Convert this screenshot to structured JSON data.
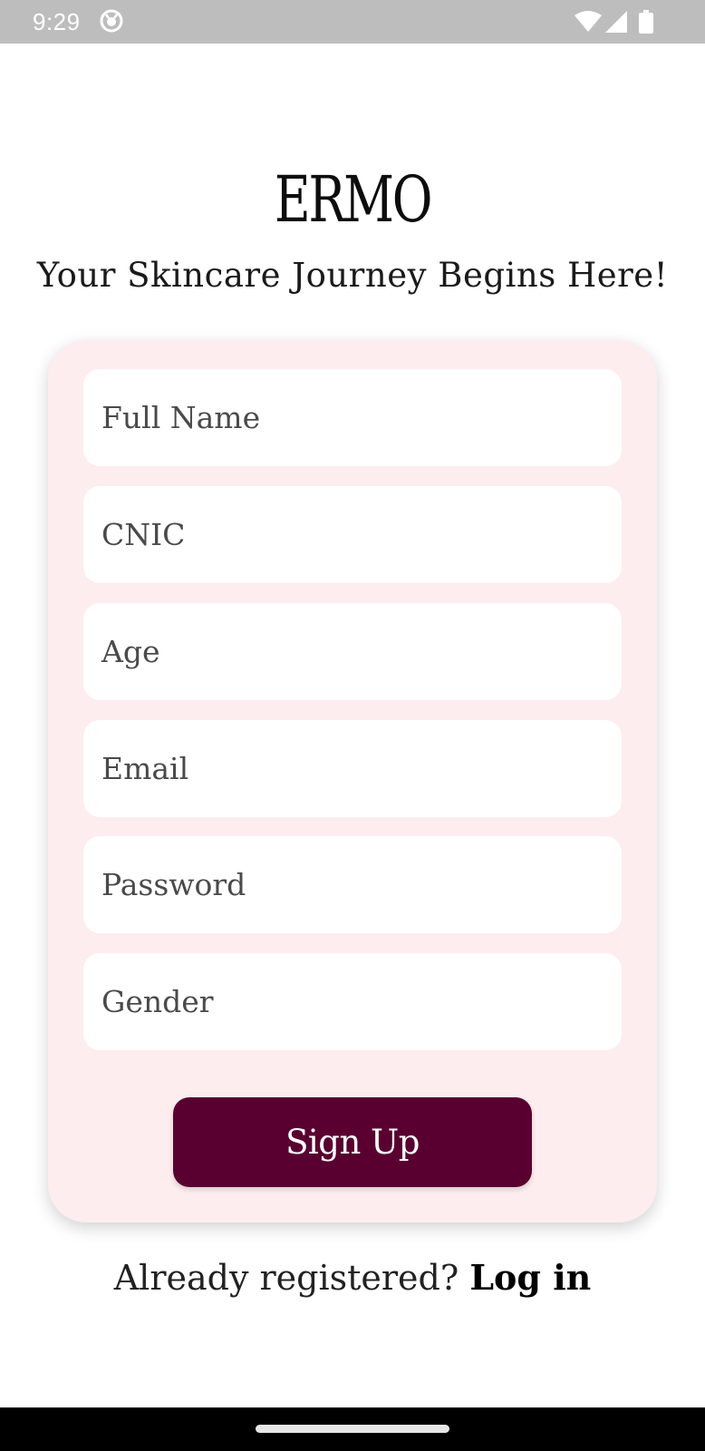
{
  "status_bar": {
    "time": "9:29",
    "icons": [
      "app-notification-icon",
      "wifi-icon",
      "cellular-signal-icon",
      "battery-icon"
    ]
  },
  "logo_text": "ERMO",
  "tagline": "Your Skincare Journey Begins Here!",
  "form": {
    "fields": [
      {
        "placeholder": "Full Name",
        "value": ""
      },
      {
        "placeholder": "CNIC",
        "value": ""
      },
      {
        "placeholder": "Age",
        "value": ""
      },
      {
        "placeholder": "Email",
        "value": ""
      },
      {
        "placeholder": "Password",
        "value": ""
      },
      {
        "placeholder": "Gender",
        "value": ""
      }
    ],
    "submit_label": "Sign Up"
  },
  "login_prompt": {
    "question": "Already registered?",
    "link_label": "Log in"
  },
  "colors": {
    "accent": "#590030",
    "card_background": "#fdedef",
    "status_bar": "#bdbdbd",
    "nav_bar": "#000000"
  }
}
